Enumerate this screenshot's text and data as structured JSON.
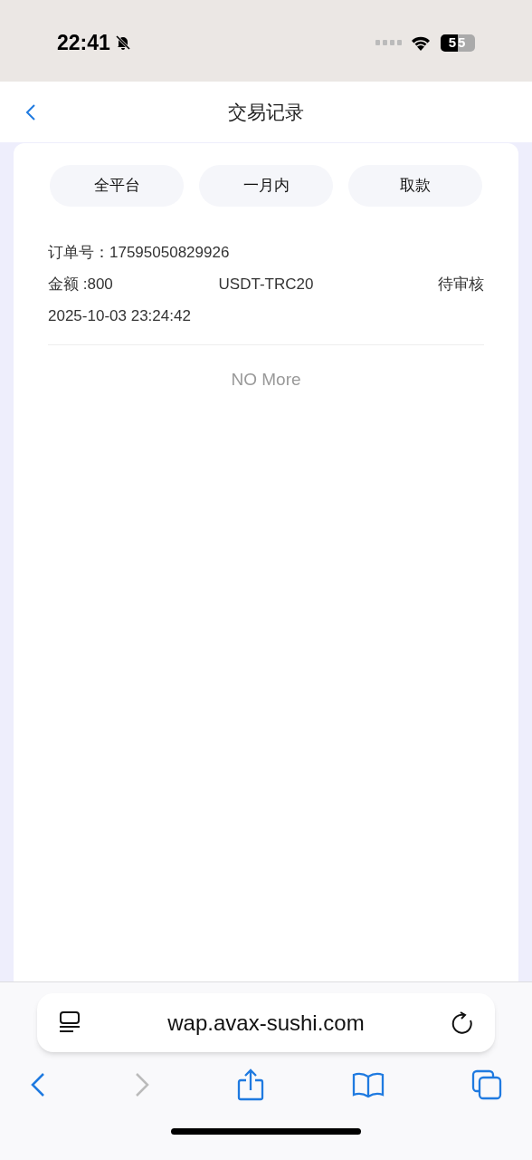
{
  "status_bar": {
    "time": "22:41",
    "battery": "55"
  },
  "header": {
    "title": "交易记录"
  },
  "filters": [
    {
      "label": "全平台"
    },
    {
      "label": "一月内"
    },
    {
      "label": "取款"
    }
  ],
  "records": [
    {
      "order_label": "订单号：",
      "order_no": "17595050829926",
      "amount": "金额 :800",
      "currency": "USDT-TRC20",
      "status": "待审核",
      "time": "2025-10-03 23:24:42"
    }
  ],
  "end_text": "NO More",
  "browser": {
    "url": "wap.avax-sushi.com",
    "forward_disabled": true
  }
}
